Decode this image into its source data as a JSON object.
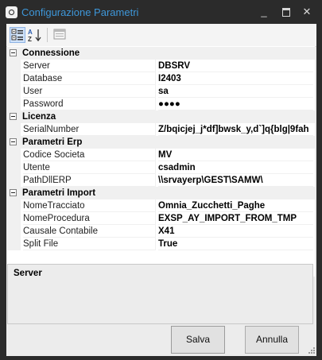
{
  "window": {
    "title": "Configurazione Parametri"
  },
  "window_controls": {
    "minimize": "_",
    "close": "✕"
  },
  "toolbar": {
    "categorized_icon": "categorized-icon",
    "alphabetical_icon": "sort-az-icon",
    "pages_icon": "property-pages-icon"
  },
  "categories": [
    {
      "label": "Connessione",
      "props": [
        {
          "name": "Server",
          "value": "DBSRV"
        },
        {
          "name": "Database",
          "value": "I2403"
        },
        {
          "name": "User",
          "value": "sa"
        },
        {
          "name": "Password",
          "value": "●●●●"
        }
      ]
    },
    {
      "label": "Licenza",
      "props": [
        {
          "name": "SerialNumber",
          "value": "Z/bqicjej_j*df]bwsk_y,d`]q{blg|9fah"
        }
      ]
    },
    {
      "label": "Parametri Erp",
      "props": [
        {
          "name": "Codice Societa",
          "value": "MV"
        },
        {
          "name": "Utente",
          "value": "csadmin"
        },
        {
          "name": "PathDllERP",
          "value": "\\\\srvayerp\\GEST\\SAMW\\"
        }
      ]
    },
    {
      "label": "Parametri Import",
      "props": [
        {
          "name": "NomeTracciato",
          "value": "Omnia_Zucchetti_Paghe"
        },
        {
          "name": "NomeProcedura",
          "value": "EXSP_AY_IMPORT_FROM_TMP"
        },
        {
          "name": "Causale Contabile",
          "value": "X41"
        },
        {
          "name": "Split File",
          "value": "True"
        }
      ]
    }
  ],
  "description": {
    "title": "Server"
  },
  "buttons": {
    "save": "Salva",
    "cancel": "Annulla"
  },
  "colors": {
    "title": "#3e97d9",
    "frame": "#2b2b2b"
  }
}
